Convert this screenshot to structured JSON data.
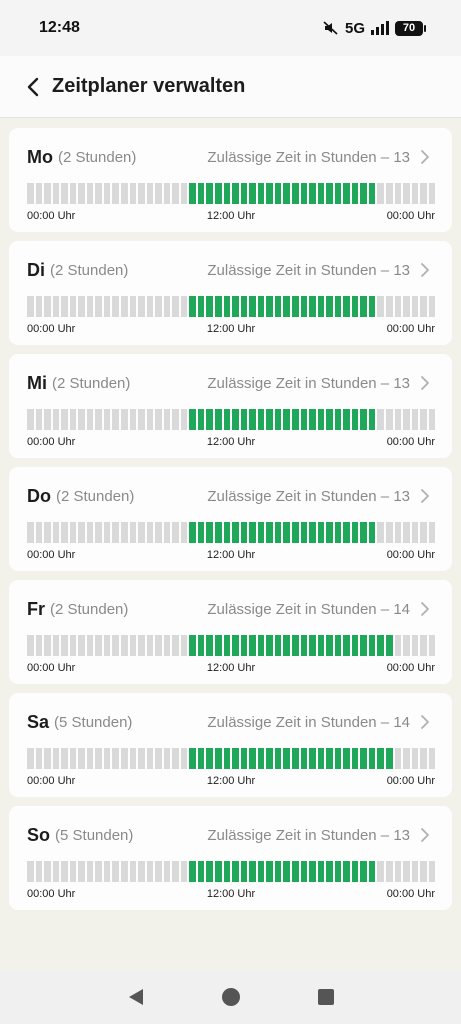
{
  "status_bar": {
    "time": "12:48",
    "network": "5G",
    "battery": "70",
    "icons": [
      "mute-icon",
      "signal-icon",
      "battery-icon"
    ]
  },
  "header": {
    "title": "Zeitplaner verwalten",
    "back_icon": "chevron-left-icon"
  },
  "schedule": [
    {
      "day": "Mo",
      "hours": "(2 Stunden)",
      "allowed": "Zulässige Zeit in Stunden – 13",
      "active_start": 19,
      "active_end": 41
    },
    {
      "day": "Di",
      "hours": "(2 Stunden)",
      "allowed": "Zulässige Zeit in Stunden – 13",
      "active_start": 19,
      "active_end": 41
    },
    {
      "day": "Mi",
      "hours": "(2 Stunden)",
      "allowed": "Zulässige Zeit in Stunden – 13",
      "active_start": 19,
      "active_end": 41
    },
    {
      "day": "Do",
      "hours": "(2 Stunden)",
      "allowed": "Zulässige Zeit in Stunden – 13",
      "active_start": 19,
      "active_end": 41
    },
    {
      "day": "Fr",
      "hours": "(2 Stunden)",
      "allowed": "Zulässige Zeit in Stunden – 14",
      "active_start": 19,
      "active_end": 43
    },
    {
      "day": "Sa",
      "hours": "(5 Stunden)",
      "allowed": "Zulässige Zeit in Stunden – 14",
      "active_start": 19,
      "active_end": 43
    },
    {
      "day": "So",
      "hours": "(5 Stunden)",
      "allowed": "Zulässige Zeit in Stunden – 13",
      "active_start": 19,
      "active_end": 41
    }
  ],
  "time_labels": {
    "start": "00:00 Uhr",
    "mid": "12:00 Uhr",
    "end": "00:00 Uhr"
  },
  "segments_total": 48,
  "colors": {
    "active": "#1fa85a",
    "inactive": "#d9d9d9"
  },
  "nav_bar": {
    "icons": [
      "back-triangle-icon",
      "home-circle-icon",
      "recents-square-icon"
    ]
  }
}
